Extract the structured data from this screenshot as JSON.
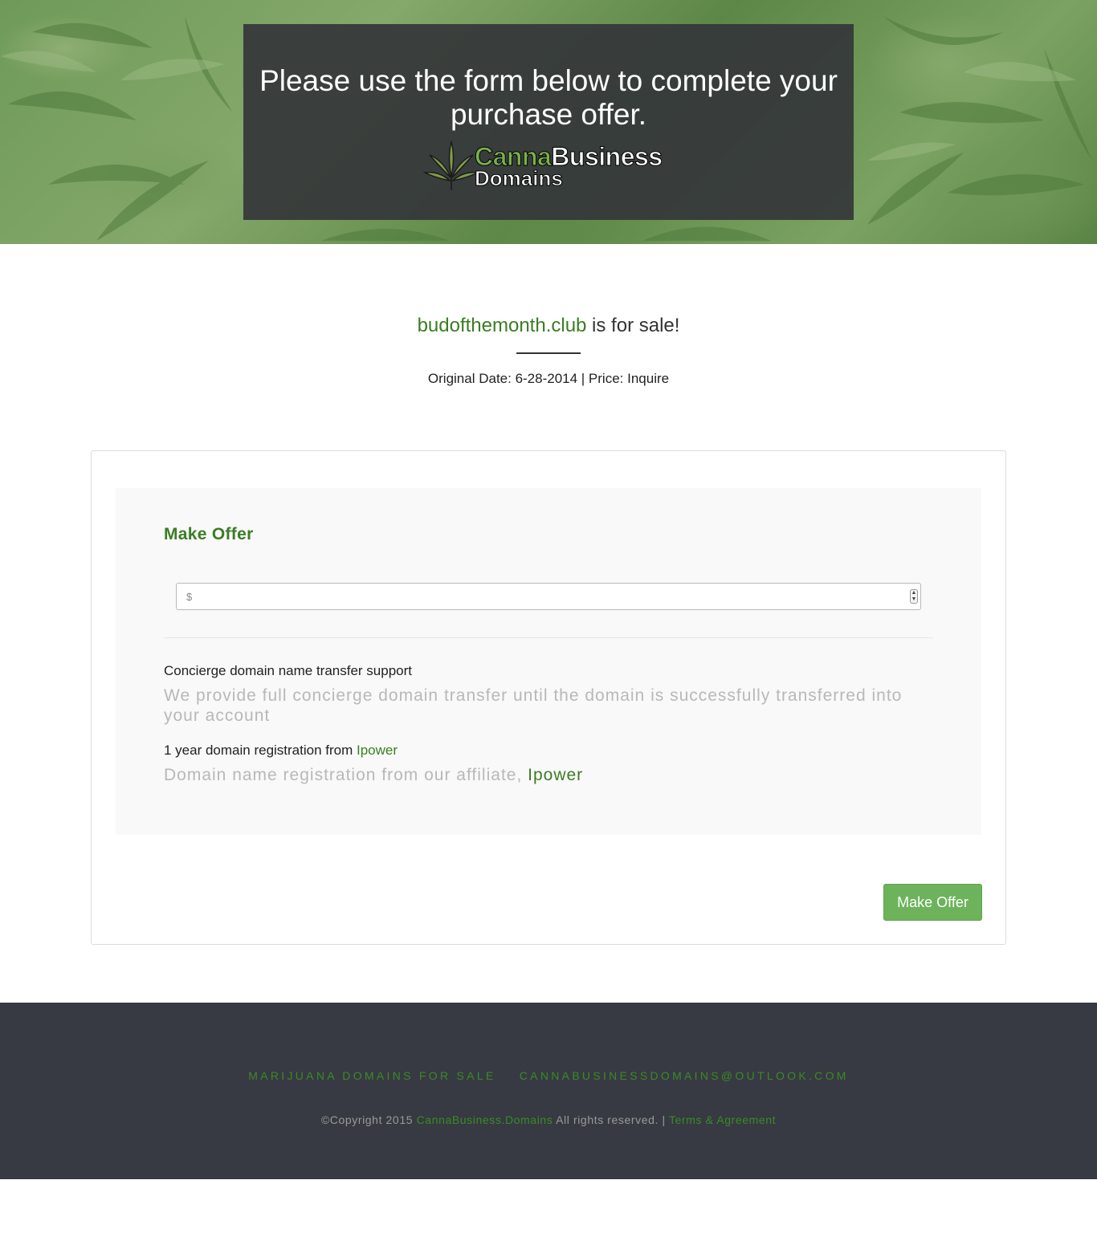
{
  "hero": {
    "title": "Please use the form below to complete your purchase offer.",
    "logo": {
      "word_canna": "Canna",
      "word_business": "Business",
      "word_domains": "Domains"
    }
  },
  "listing": {
    "domain": "budofthemonth.club",
    "for_sale_text": " is for sale!",
    "meta": "Original Date: 6-28-2014 | Price: Inquire"
  },
  "form": {
    "heading": "Make Offer",
    "offer_input": {
      "value": "",
      "placeholder": "$"
    },
    "features": [
      {
        "title": "Concierge domain name transfer support",
        "description": "We provide full concierge domain transfer until the domain is successfully transferred into your account"
      },
      {
        "title_prefix": "1 year domain registration from ",
        "title_link": "Ipower",
        "description_prefix": "Domain name registration from our affiliate, ",
        "description_link": "Ipower"
      }
    ],
    "submit_label": "Make Offer"
  },
  "footer": {
    "links": [
      "MARIJUANA DOMAINS FOR SALE",
      "CANNABUSINESSDOMAINS@OUTLOOK.COM"
    ],
    "copyright_prefix": "©Copyright 2015 ",
    "copyright_brand": "CannaBusiness.Domains",
    "copyright_middle": " All rights reserved. | ",
    "terms_link": "Terms & Agreement"
  },
  "colors": {
    "accent_green": "#3a7d23",
    "button_green": "#6cb35c",
    "footer_bg": "#373a42",
    "hero_card_bg": "#34363a"
  },
  "icons": {
    "logo": "cannabis-leaf-icon",
    "spinner": "number-spinner-icon"
  }
}
